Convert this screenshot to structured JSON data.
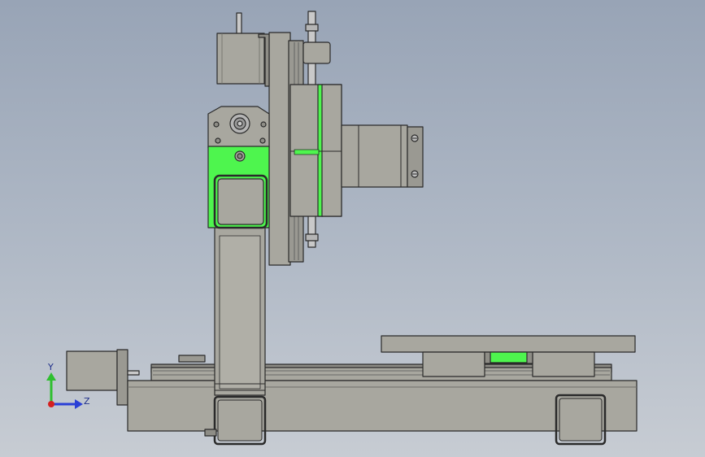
{
  "viewport": {
    "background_top": "#98a4b6",
    "background_bottom": "#c7ccd3"
  },
  "colors": {
    "metal_body": "#a8a79f",
    "metal_dark": "#8e8d86",
    "edge": "#2a2a2a",
    "highlight": "#4ef54e",
    "rod": "#c9c9c9"
  },
  "triad": {
    "y_label": "Y",
    "z_label": "Z",
    "y_color": "#2fbf2f",
    "z_color": "#2a3fd6",
    "origin_color": "#d42020"
  }
}
